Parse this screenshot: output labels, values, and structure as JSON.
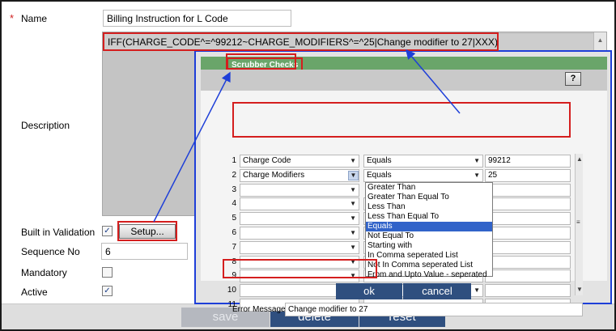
{
  "form": {
    "name_label": "Name",
    "required_mark": "*",
    "name_value": "Billing Instruction for L Code",
    "description_label": "Description",
    "description_value": "IFF(CHARGE_CODE^=^99212~CHARGE_MODIFIERS^=^25|Change modifier to 27|XXX)",
    "built_in_validation_label": "Built in Validation",
    "setup_label": "Setup...",
    "sequence_label": "Sequence No",
    "sequence_value": "6",
    "mandatory_label": "Mandatory",
    "active_label": "Active",
    "built_in_validation_checked": true,
    "mandatory_checked": false,
    "active_checked": true
  },
  "dialog": {
    "title": "Scrubber Checks",
    "help_label": "?",
    "rows": [
      {
        "num": "1",
        "field": "Charge Code",
        "operator": "Equals",
        "value": "99212"
      },
      {
        "num": "2",
        "field": "Charge Modifiers",
        "operator": "Equals",
        "value": "25"
      },
      {
        "num": "3",
        "field": "",
        "operator": "",
        "value": ""
      },
      {
        "num": "4",
        "field": "",
        "operator": "",
        "value": ""
      },
      {
        "num": "5",
        "field": "",
        "operator": "",
        "value": ""
      },
      {
        "num": "6",
        "field": "",
        "operator": "",
        "value": ""
      },
      {
        "num": "7",
        "field": "",
        "operator": "",
        "value": ""
      },
      {
        "num": "8",
        "field": "",
        "operator": "",
        "value": ""
      },
      {
        "num": "9",
        "field": "",
        "operator": "",
        "value": ""
      },
      {
        "num": "10",
        "field": "",
        "operator": "",
        "value": ""
      },
      {
        "num": "11",
        "field": "",
        "operator": "",
        "value": ""
      }
    ],
    "operator_options": [
      "Greater Than",
      "Greater Than Equal To",
      "Less Than",
      "Less Than Equal To",
      "Equals",
      "Not Equal To",
      "Starting with",
      "In Comma seperated List",
      "Not In Comma seperated List",
      "From and Upto Value - seperated"
    ],
    "selected_operator": "Equals",
    "error_label": "Error Message",
    "error_value": "Change modifier to 27",
    "ok_label": "ok",
    "cancel_label": "cancel"
  },
  "toolbar": {
    "save_label": "save",
    "delete_label": "delete",
    "reset_label": "reset"
  },
  "colors": {
    "accent_button": "#2f4f7f",
    "highlight_red": "#d41e1e",
    "dialog_border_blue": "#1e3fd8",
    "dialog_header_green": "#6aa56a",
    "selected_option": "#3163c9"
  },
  "icons": {
    "dropdown_arrow": "chevron-down-icon",
    "checkmark": "check-icon",
    "scroll_up": "scroll-up-arrow-icon",
    "scroll_down": "scroll-down-arrow-icon"
  }
}
